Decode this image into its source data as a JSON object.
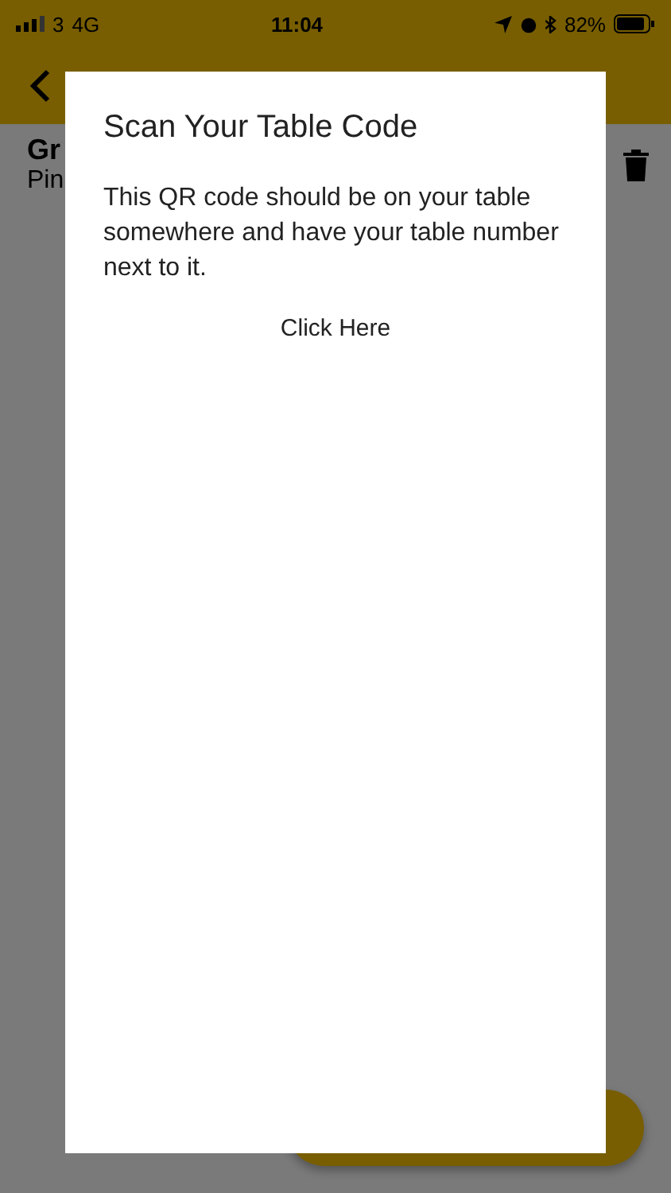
{
  "status_bar": {
    "carrier": "3",
    "network": "4G",
    "time": "11:04",
    "battery": "82%"
  },
  "background": {
    "item_name": "Gr",
    "item_detail": "Pin"
  },
  "dialog": {
    "title": "Scan Your Table Code",
    "message": "This QR code should be on your table somewhere and have your table number next to it.",
    "action": "Click Here"
  }
}
